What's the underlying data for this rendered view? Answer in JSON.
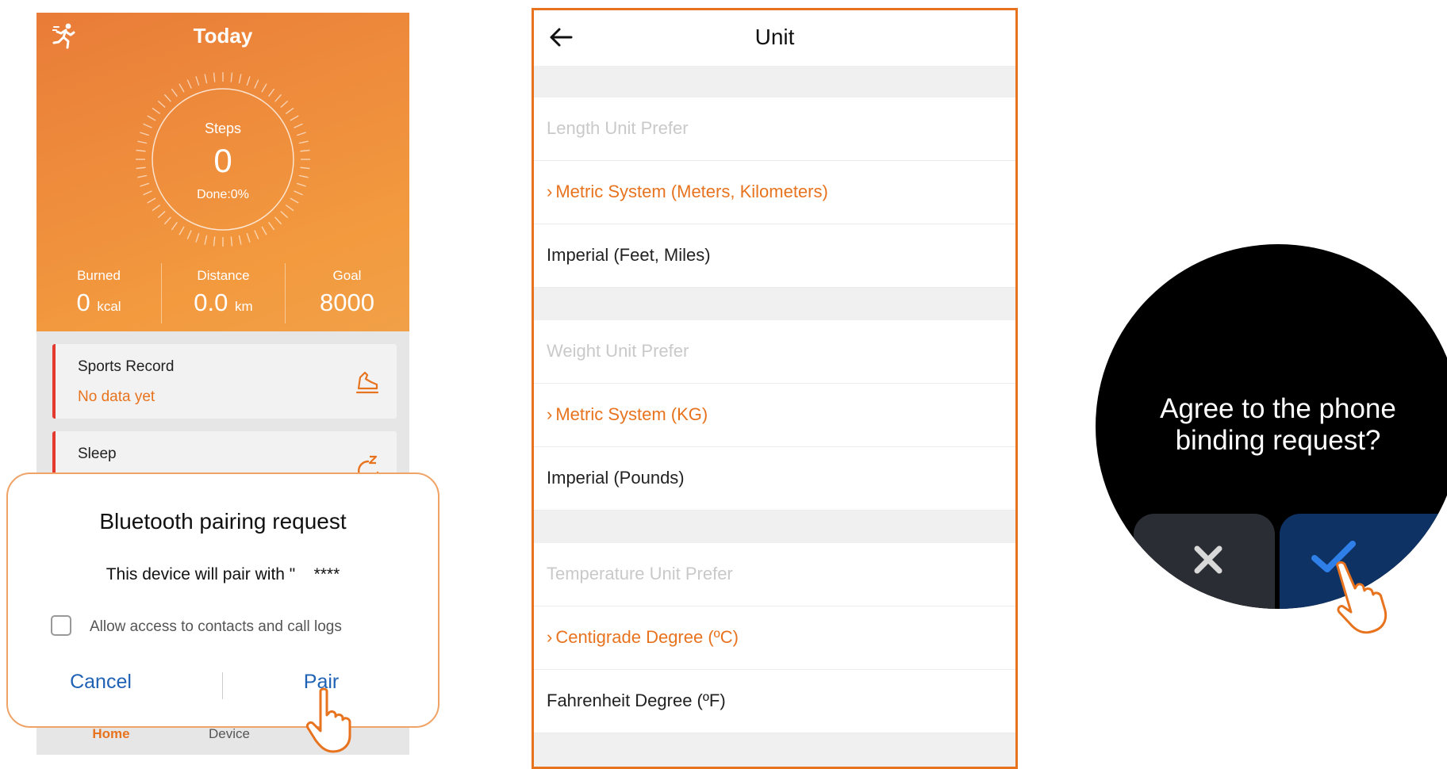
{
  "phone1": {
    "title": "Today",
    "steps_label": "Steps",
    "steps_value": "0",
    "done": "Done:0%",
    "stats": {
      "burned": {
        "label": "Burned",
        "value": "0",
        "unit": "kcal"
      },
      "distance": {
        "label": "Distance",
        "value": "0.0",
        "unit": "km"
      },
      "goal": {
        "label": "Goal",
        "value": "8000"
      }
    },
    "cards": {
      "sports_title": "Sports Record",
      "sports_status": "No data yet",
      "sleep_title": "Sleep"
    },
    "nav": {
      "home": "Home",
      "device": "Device"
    },
    "dialog": {
      "title": "Bluetooth pairing request",
      "message": "This device will pair with \"    ****",
      "checkbox_label": "Allow access to contacts and call logs",
      "cancel": "Cancel",
      "pair": "Pair"
    },
    "icons": [
      "running-person-icon",
      "sports-shoe-icon",
      "sleep-icon",
      "pointing-hand-icon"
    ],
    "colors": {
      "accent": "#e8731e",
      "header_gradient_start": "#e97c38",
      "button_blue": "#1f62b5",
      "card_marker": "#e43a2e"
    }
  },
  "phone2": {
    "title": "Unit",
    "rows": [
      {
        "type": "header",
        "label": "Length Unit Prefer"
      },
      {
        "type": "selected",
        "label": "Metric System (Meters, Kilometers)"
      },
      {
        "type": "normal",
        "label": "Imperial (Feet, Miles)"
      },
      {
        "type": "header",
        "label": "Weight Unit Prefer"
      },
      {
        "type": "selected",
        "label": "Metric System (KG)"
      },
      {
        "type": "normal",
        "label": "Imperial (Pounds)"
      },
      {
        "type": "header",
        "label": "Temperature Unit Prefer"
      },
      {
        "type": "selected",
        "label": "Centigrade Degree (ºC)"
      },
      {
        "type": "normal",
        "label": "Fahrenheit Degree (ºF)"
      }
    ],
    "icons": [
      "back-arrow-icon",
      "chevron-right-icon"
    ]
  },
  "watch": {
    "question": "Agree to the phone binding request?",
    "icons": [
      "close-icon",
      "checkmark-icon",
      "pointing-hand-icon"
    ],
    "colors": {
      "confirm": "#0e3264",
      "check": "#2f7fe8",
      "cancel_bg": "#2a2d33"
    }
  }
}
